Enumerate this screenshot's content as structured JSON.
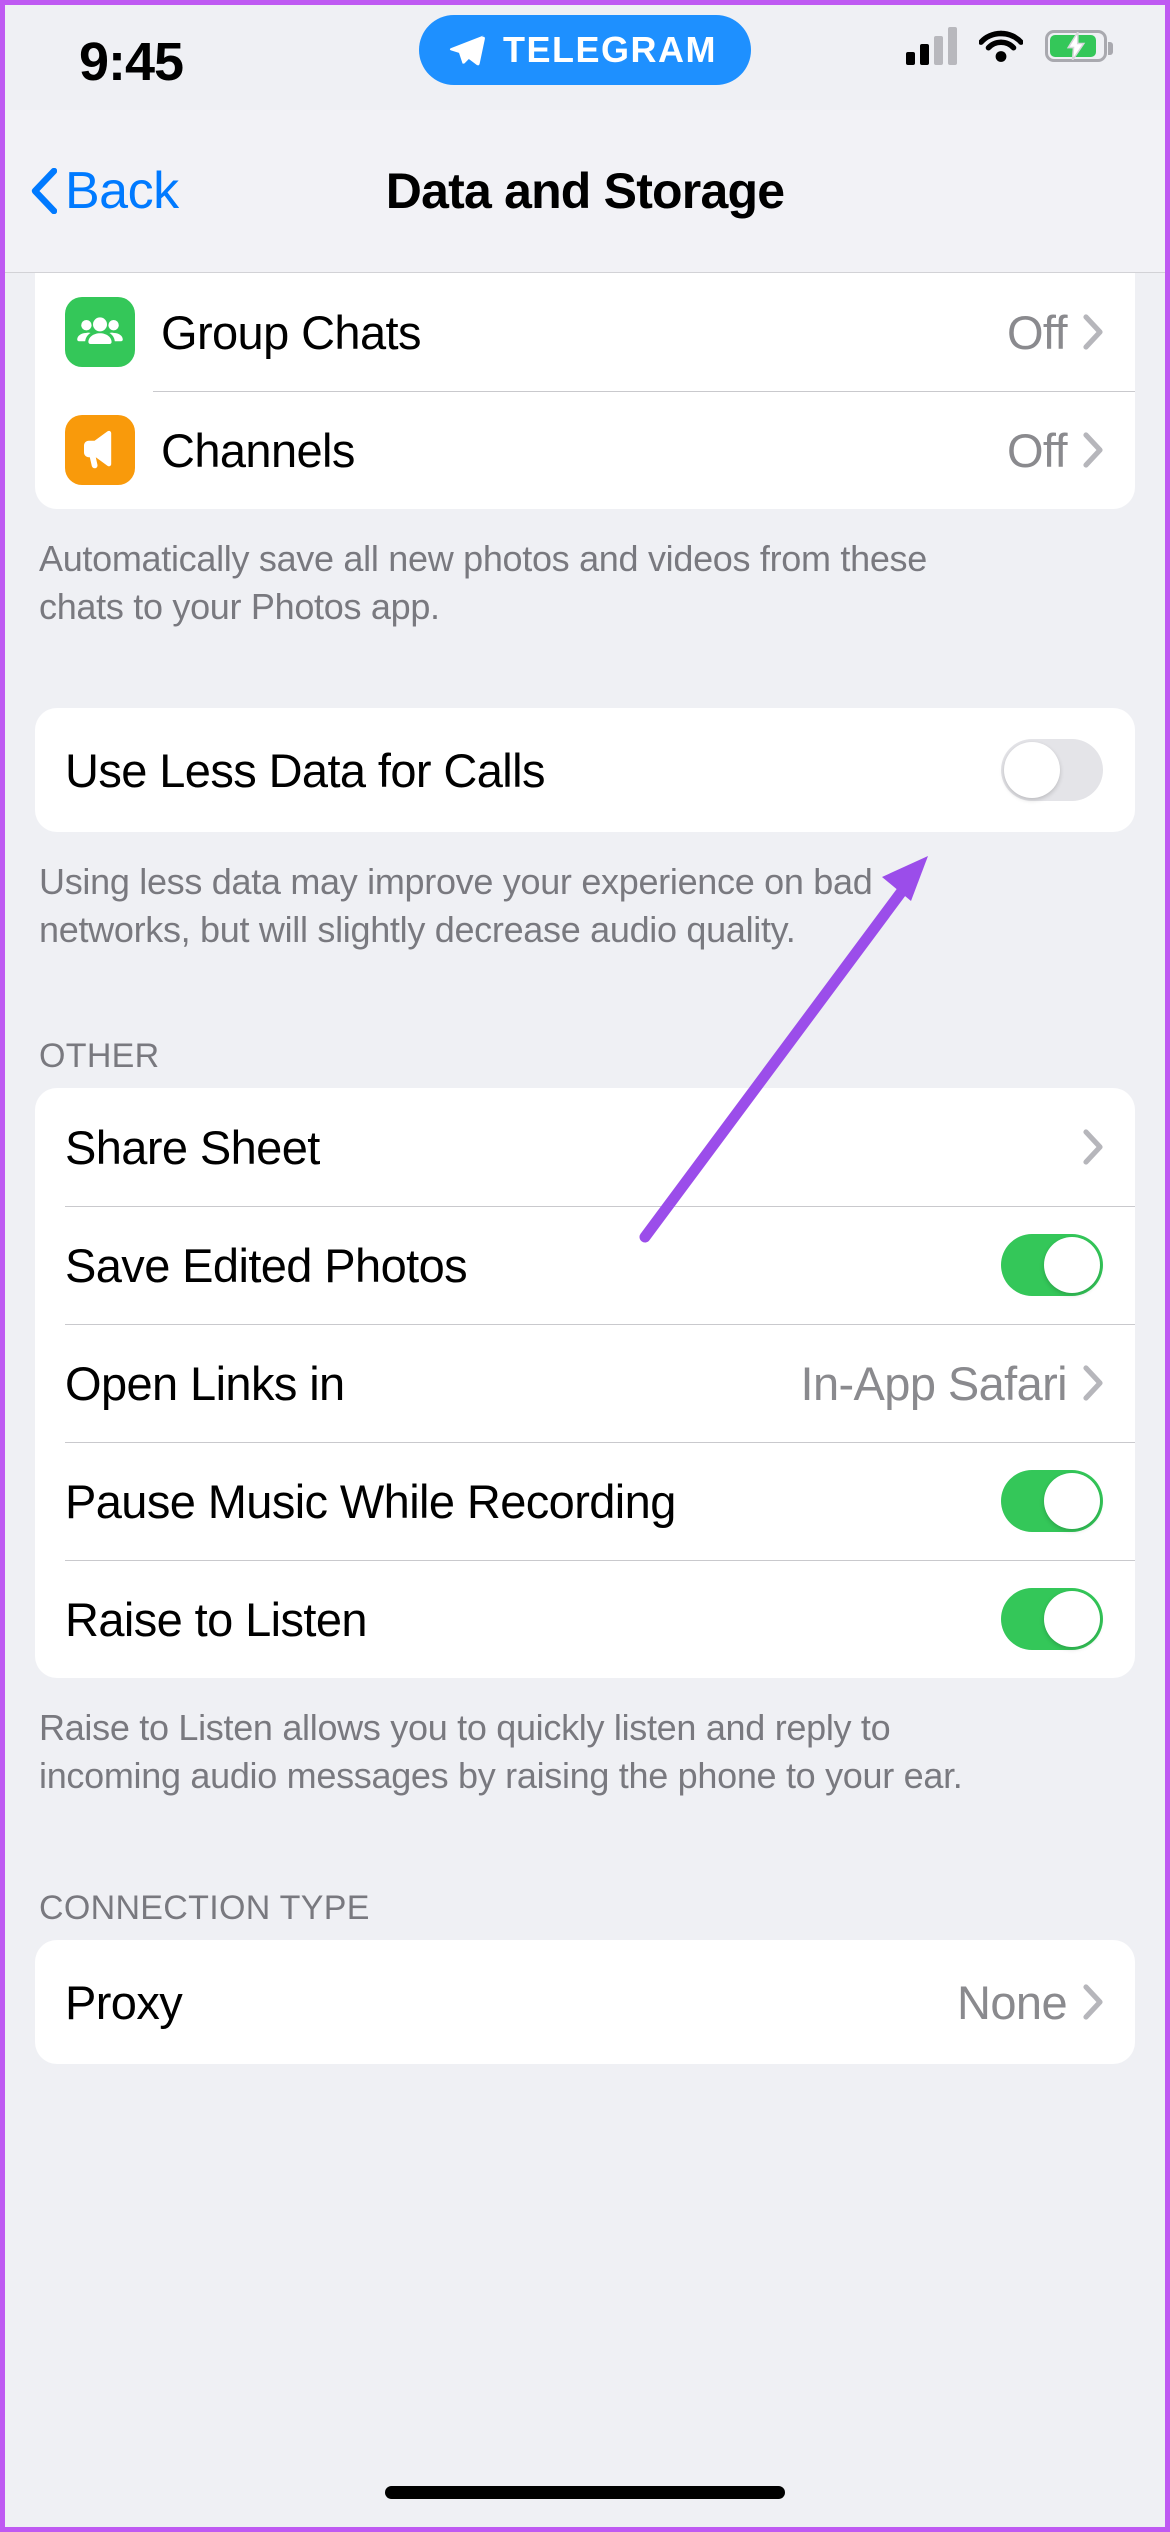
{
  "status_bar": {
    "time": "9:45",
    "dynamic_island_label": "TELEGRAM",
    "telegram_icon": "telegram-plane-icon",
    "cellular_icon": "cellular-signal-icon",
    "wifi_icon": "wifi-icon",
    "battery_icon": "battery-charging-icon"
  },
  "nav": {
    "back_label": "Back",
    "back_icon": "chevron-left-icon",
    "title": "Data and Storage"
  },
  "autosave_group": {
    "rows": [
      {
        "label": "Group Chats",
        "value": "Off",
        "icon": "group-people-icon",
        "icon_color": "#34c759",
        "accessory": "chevron-right-icon"
      },
      {
        "label": "Channels",
        "value": "Off",
        "icon": "megaphone-icon",
        "icon_color": "#f99a0b",
        "accessory": "chevron-right-icon"
      }
    ],
    "footnote": "Automatically save all new photos and videos from these chats to your Photos app."
  },
  "calls_group": {
    "rows": [
      {
        "label": "Use Less Data for Calls",
        "toggle": "off"
      }
    ],
    "footnote": "Using less data may improve your experience on bad networks, but will slightly decrease audio quality."
  },
  "other_section": {
    "header": "OTHER",
    "rows": [
      {
        "label": "Share Sheet",
        "value": "",
        "accessory": "chevron-right-icon"
      },
      {
        "label": "Save Edited Photos",
        "toggle": "on"
      },
      {
        "label": "Open Links in",
        "value": "In-App Safari",
        "accessory": "chevron-right-icon"
      },
      {
        "label": "Pause Music While Recording",
        "toggle": "on"
      },
      {
        "label": "Raise to Listen",
        "toggle": "on"
      }
    ],
    "footnote": "Raise to Listen allows you to quickly listen and reply to incoming audio messages by raising the phone to your ear."
  },
  "connection_section": {
    "header": "CONNECTION TYPE",
    "rows": [
      {
        "label": "Proxy",
        "value": "None",
        "accessory": "chevron-right-icon"
      }
    ]
  },
  "annotation": {
    "type": "arrow",
    "color": "#9b4dea",
    "points_to": "use-less-data-for-calls-toggle"
  },
  "colors": {
    "accent_blue": "#007aff",
    "toggle_on_green": "#34c759",
    "toggle_off_gray": "#e4e4e8",
    "page_background": "#eff0f4",
    "card_background": "#ffffff",
    "secondary_text": "#8a8a8e",
    "device_frame": "#bf5af2"
  }
}
